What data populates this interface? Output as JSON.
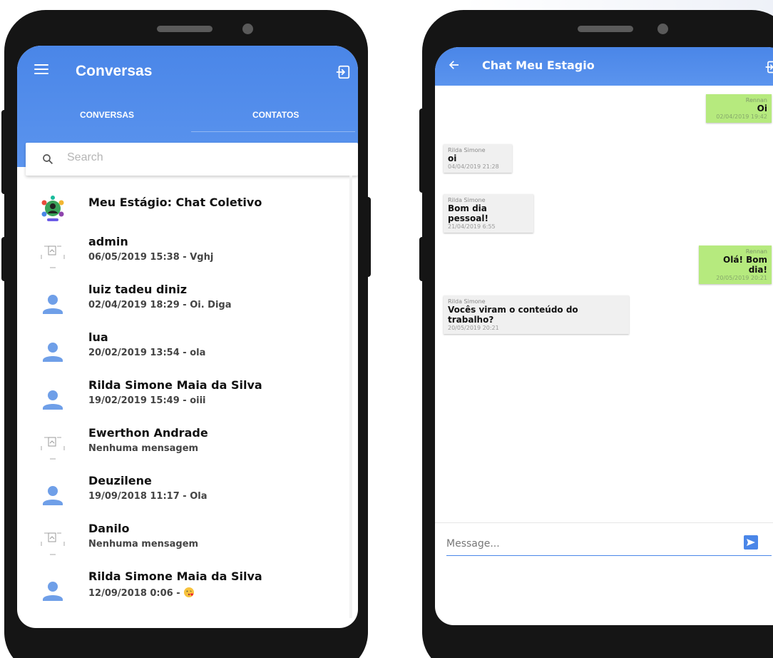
{
  "left_screen": {
    "appbar": {
      "title": "Conversas"
    },
    "tabs": [
      {
        "label": "CONVERSAS",
        "active": true
      },
      {
        "label": "CONTATOS",
        "active": false
      }
    ],
    "search": {
      "placeholder": "Search",
      "value": ""
    },
    "conversations": [
      {
        "name": "Meu Estágio: Chat Coletivo",
        "subtitle": "",
        "avatar": "group-logo-icon"
      },
      {
        "name": "admin",
        "subtitle": "06/05/2019 15:38 - Vghj",
        "avatar": "broken-image-icon"
      },
      {
        "name": "luiz tadeu diniz",
        "subtitle": "02/04/2019 18:29 - Oi. Diga",
        "avatar": "user-icon"
      },
      {
        "name": "lua",
        "subtitle": "20/02/2019 13:54 - ola",
        "avatar": "user-icon"
      },
      {
        "name": "Rilda Simone Maia da Silva",
        "subtitle": "19/02/2019 15:49 - oiii",
        "avatar": "user-icon"
      },
      {
        "name": "Ewerthon Andrade",
        "subtitle": "Nenhuma mensagem",
        "avatar": "broken-image-icon"
      },
      {
        "name": "Deuzilene",
        "subtitle": "19/09/2018 11:17 - Ola",
        "avatar": "user-icon"
      },
      {
        "name": "Danilo",
        "subtitle": "Nenhuma mensagem",
        "avatar": "broken-image-icon"
      },
      {
        "name": "Rilda Simone Maia da Silva",
        "subtitle": "12/09/2018 0:06 - ",
        "avatar": "user-icon",
        "emoji": "kiss-emoji-icon"
      }
    ]
  },
  "right_screen": {
    "appbar": {
      "title": "Chat Meu Estagio"
    },
    "messages": [
      {
        "direction": "out",
        "sender": "Rennan",
        "text": "Oi",
        "time": "02/04/2019 19:42"
      },
      {
        "direction": "in",
        "sender": "Rilda Simone",
        "text": "oi",
        "time": "04/04/2019 21:28"
      },
      {
        "direction": "in",
        "sender": "Rilda Simone",
        "text": "Bom dia pessoal!",
        "time": "21/04/2019 6:55"
      },
      {
        "direction": "out",
        "sender": "Rennan",
        "text": "Olá! Bom dia!",
        "time": "20/05/2019 20:21"
      },
      {
        "direction": "in",
        "sender": "Rilda Simone",
        "text": "Vocês viram o conteúdo do trabalho?",
        "time": "20/05/2019 20:21"
      }
    ],
    "composer": {
      "placeholder": "Message...",
      "value": ""
    }
  },
  "colors": {
    "primary": "#4a86e8",
    "outgoing_bubble": "#b6ea7e",
    "incoming_bubble": "#f0f0f0",
    "avatar_blue": "#6f9fe8",
    "phone_frame": "#151515"
  }
}
